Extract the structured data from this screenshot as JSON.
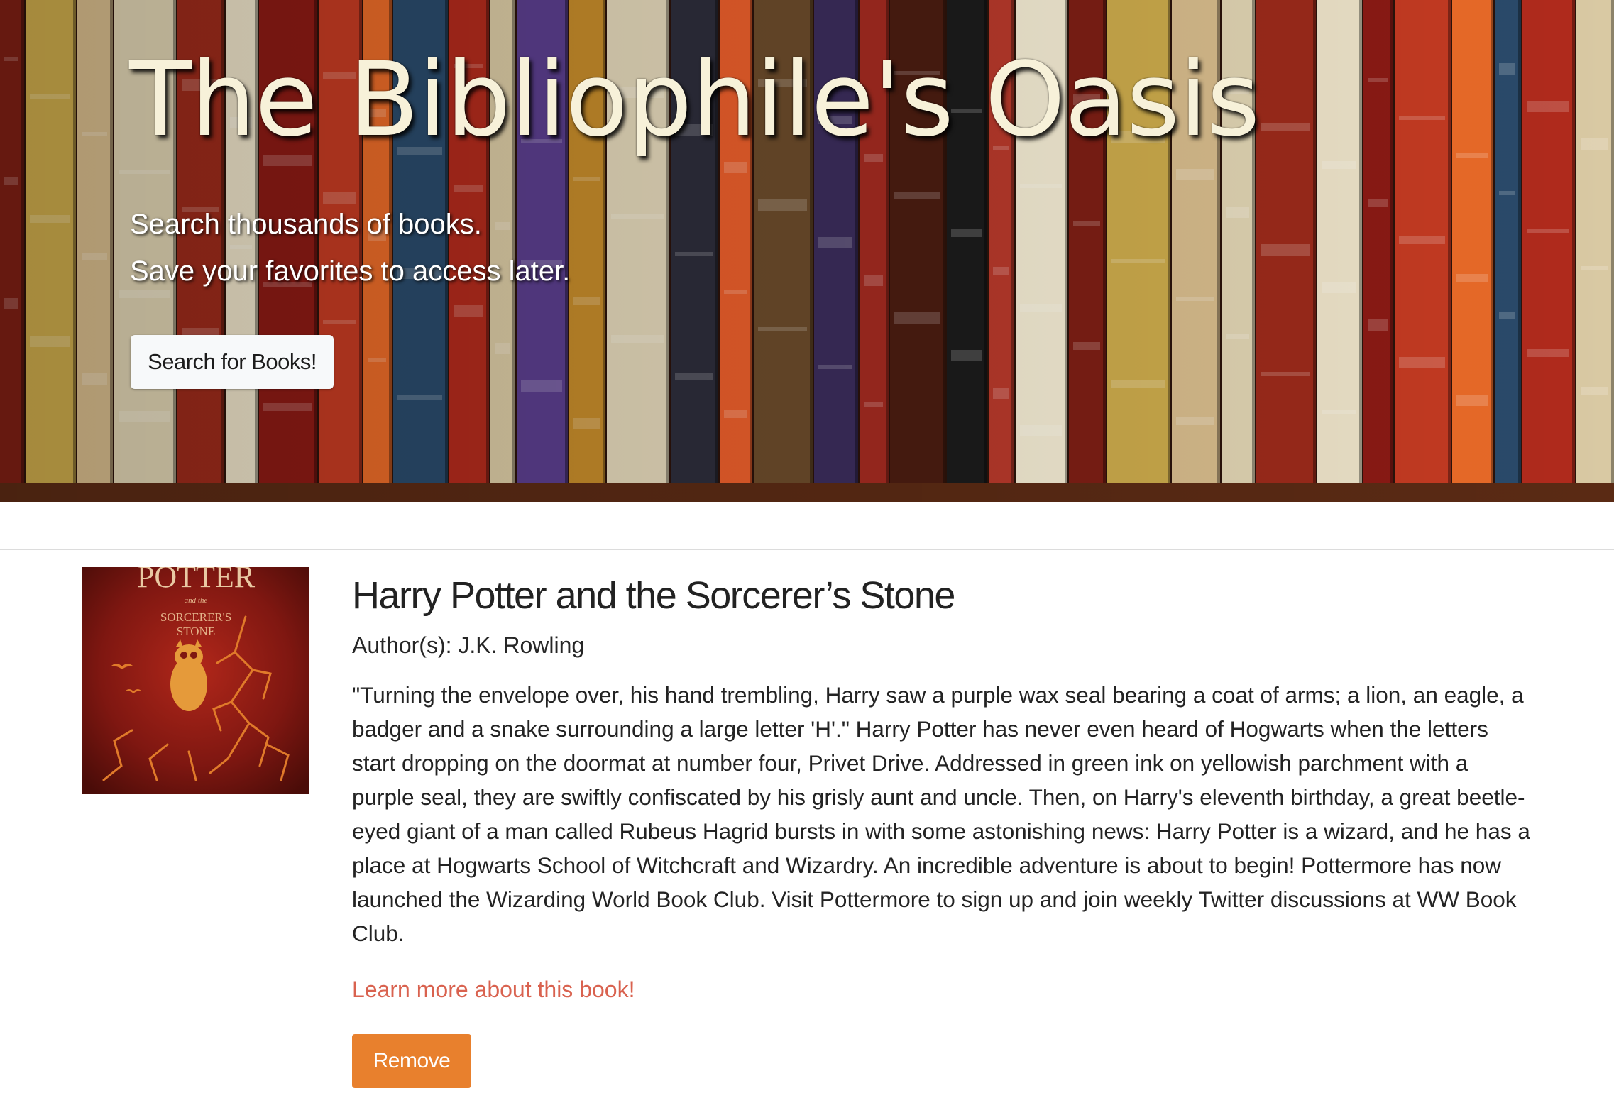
{
  "hero": {
    "title": "The Bibliophile's Oasis",
    "subtitle_line1": "Search thousands of books.",
    "subtitle_line2": "Save your favorites to access later.",
    "search_button_label": "Search for Books!"
  },
  "book": {
    "title": "Harry Potter and the Sorcerer’s Stone",
    "authors": "Author(s): J.K. Rowling",
    "description": "\"Turning the envelope over, his hand trembling, Harry saw a purple wax seal bearing a coat of arms; a lion, an eagle, a badger and a snake surrounding a large letter 'H'.\" Harry Potter has never even heard of Hogwarts when the letters start dropping on the doormat at number four, Privet Drive. Addressed in green ink on yellowish parchment with a purple seal, they are swiftly confiscated by his grisly aunt and uncle. Then, on Harry's eleventh birthday, a great beetle-eyed giant of a man called Rubeus Hagrid bursts in with some astonishing news: Harry Potter is a wizard, and he has a place at Hogwarts School of Witchcraft and Wizardry. An incredible adventure is about to begin! Pottermore has now launched the Wizarding World Book Club. Visit Pottermore to sign up and join weekly Twitter discussions at WW Book Club.",
    "learn_more_label": "Learn more about this book!",
    "remove_button_label": "Remove",
    "cover": {
      "line1": "POTTER",
      "line2": "and the",
      "line3": "SORCERER'S",
      "line4": "STONE"
    }
  },
  "colors": {
    "accent_button": "#e8802d",
    "link": "#d9624f",
    "hero_title": "#f7f1d9"
  },
  "icons": {
    "cover_art": "owl-lightning-illustration"
  }
}
